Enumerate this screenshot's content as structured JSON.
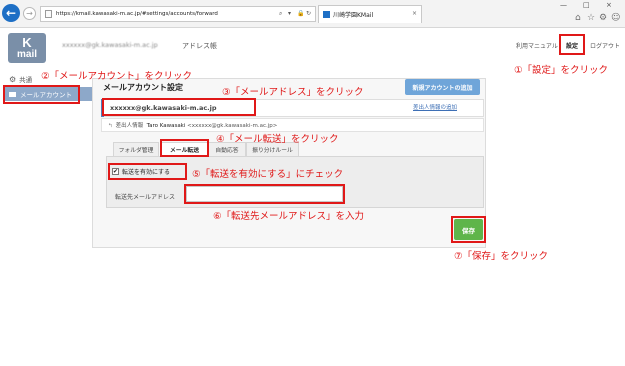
{
  "browser": {
    "url": "https://kmail.kawasaki-m.ac.jp/#settings/accounts/forward",
    "tab_title": "川崎学園KMail",
    "tab_close": "×",
    "back_glyph": "←",
    "forward_glyph": "→",
    "window_controls": [
      "—",
      "□",
      "×"
    ]
  },
  "header": {
    "logo_top": "K",
    "logo_bottom": "mail",
    "user_email": "xxxxxx@gk.kawasaki-m.ac.jp",
    "address_book": "アドレス帳",
    "links": {
      "manual": "利用マニュアル",
      "settings": "設定",
      "logout": "ログアウト"
    }
  },
  "sidebar": {
    "common": "共通",
    "mail_account": "メールアカウント"
  },
  "main": {
    "title": "メールアカウント設定",
    "new_account_button": "新規アカウントの追加",
    "account_email": "xxxxxx@gk.kawasaki-m.ac.jp",
    "add_sender_link": "差出人情報の追加",
    "sender_label": "差出人情報",
    "sender_name": "Taro Kawasaki",
    "sender_address": "<xxxxxx@gk.kawasaki-m.ac.jp>",
    "tabs": [
      "フォルダ管理",
      "メール転送",
      "自動応答",
      "振り分けルール"
    ],
    "active_tab_index": 1,
    "enable_forward_label": "転送を有効にする",
    "enable_forward_checked": true,
    "checkmark": "✔",
    "forward_address_label": "転送先メールアドレス",
    "forward_address_value": "",
    "save_button": "保存"
  },
  "annotations": {
    "step1": "①「設定」をクリック",
    "step2": "②「メールアカウント」をクリック",
    "step3": "③「メールアドレス」をクリック",
    "step4": "④「メール転送」をクリック",
    "step5": "⑤「転送を有効にする」にチェック",
    "step6": "⑥「転送先メールアドレス」を入力",
    "step7": "⑦「保存」をクリック",
    "color": "#e01818"
  },
  "colors": {
    "primary_blue": "#6fa5d9",
    "save_green": "#5fb54a",
    "sidebar_selected": "#8da8c9",
    "logo_bg": "#7a8fa8"
  }
}
